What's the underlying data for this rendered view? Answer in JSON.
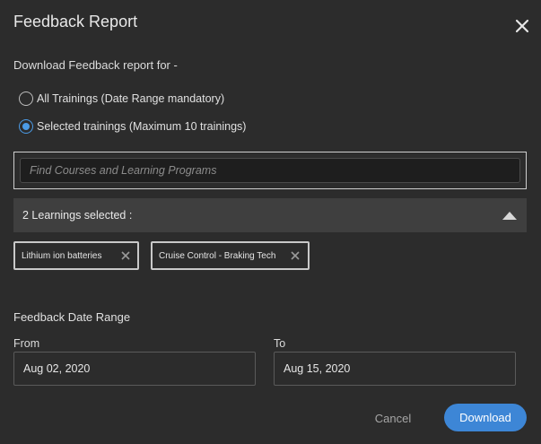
{
  "dialog": {
    "title": "Feedback Report",
    "close_icon": "close-icon"
  },
  "download_for": {
    "heading": "Download Feedback report for -",
    "options": [
      {
        "label": "All Trainings (Date Range mandatory)",
        "selected": false
      },
      {
        "label": "Selected trainings (Maximum 10 trainings)",
        "selected": true
      }
    ]
  },
  "search": {
    "placeholder": "Find Courses and Learning Programs",
    "value": ""
  },
  "selection": {
    "summary": "2 Learnings selected :",
    "expanded": true,
    "chips": [
      {
        "label": "Lithium ion batteries"
      },
      {
        "label": "Cruise Control - Braking Tech"
      }
    ]
  },
  "date_range": {
    "heading": "Feedback Date Range",
    "from_label": "From",
    "from_value": "Aug 02, 2020",
    "to_label": "To",
    "to_value": "Aug 15, 2020"
  },
  "actions": {
    "cancel_label": "Cancel",
    "download_label": "Download"
  },
  "colors": {
    "background": "#2c2c2c",
    "accent": "#3d86d6",
    "bar": "#3f3f3f"
  }
}
